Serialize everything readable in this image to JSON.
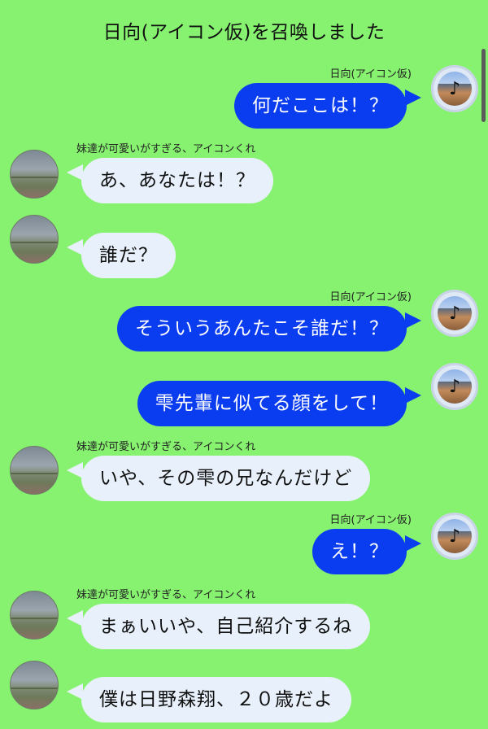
{
  "header": {
    "title": "日向(アイコン仮)を召喚しました"
  },
  "messages": [
    {
      "side": "right",
      "name": "日向(アイコン仮)",
      "text": "何だここは！？"
    },
    {
      "side": "left",
      "name": "妹達が可愛いがすぎる、アイコンくれ",
      "text": "あ、あなたは！？"
    },
    {
      "side": "left",
      "name": "",
      "text": "誰だ？"
    },
    {
      "side": "right",
      "name": "日向(アイコン仮)",
      "text": "そういうあんたこそ誰だ！？"
    },
    {
      "side": "right",
      "name": "",
      "text": "雫先輩に似てる顔をして！"
    },
    {
      "side": "left",
      "name": "妹達が可愛いがすぎる、アイコンくれ",
      "text": "いや、その雫の兄なんだけど"
    },
    {
      "side": "right",
      "name": "日向(アイコン仮)",
      "text": "え！？"
    },
    {
      "side": "left",
      "name": "妹達が可愛いがすぎる、アイコンくれ",
      "text": "まぁいいや、自己紹介するね"
    },
    {
      "side": "left",
      "name": "",
      "text": "僕は日野森翔、２０歳だよ"
    }
  ],
  "icons": {
    "right_avatar_glyph": "♪"
  },
  "colors": {
    "background": "#86f26f",
    "left_bubble": "#e8f1fb",
    "right_bubble": "#0a3cf0"
  }
}
